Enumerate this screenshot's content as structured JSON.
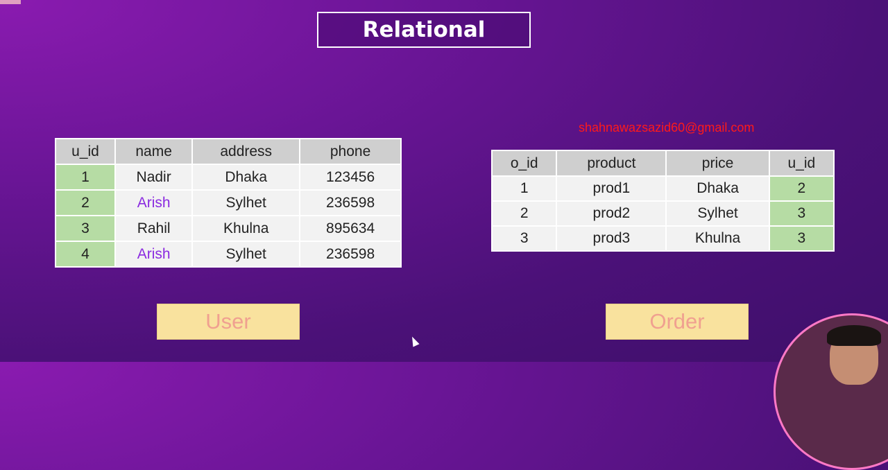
{
  "title": "Relational",
  "email": "shahnawazsazid60@gmail.com",
  "user_table": {
    "headers": [
      "u_id",
      "name",
      "address",
      "phone"
    ],
    "rows": [
      [
        "1",
        "Nadir",
        "Dhaka",
        "123456"
      ],
      [
        "2",
        "Arish",
        "Sylhet",
        "236598"
      ],
      [
        "3",
        "Rahil",
        "Khulna",
        "895634"
      ],
      [
        "4",
        "Arish",
        "Sylhet",
        "236598"
      ]
    ]
  },
  "order_table": {
    "headers": [
      "o_id",
      "product",
      "price",
      "u_id"
    ],
    "rows": [
      [
        "1",
        "prod1",
        "Dhaka",
        "2"
      ],
      [
        "2",
        "prod2",
        "Sylhet",
        "3"
      ],
      [
        "3",
        "prod3",
        "Khulna",
        "3"
      ]
    ]
  },
  "labels": {
    "user": "User",
    "order": "Order"
  },
  "colors": {
    "key_cell": "#b6dca4",
    "highlight_text": "#8b2be0",
    "email_text": "#ff1a1a",
    "label_bg": "#f9e29e",
    "label_text": "#f0a090"
  }
}
